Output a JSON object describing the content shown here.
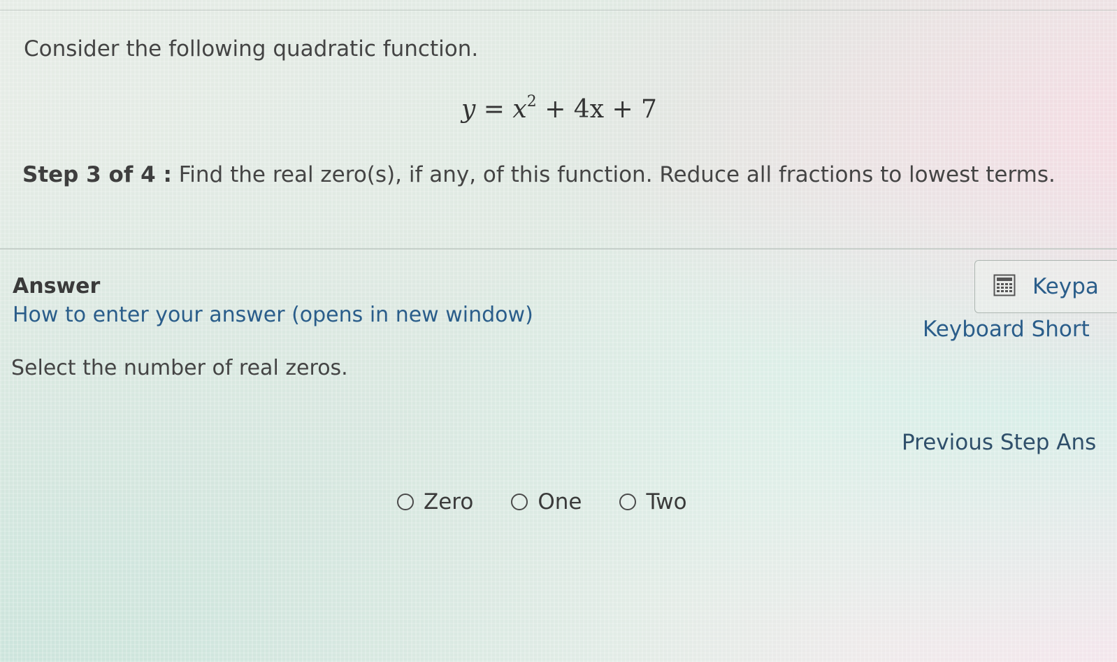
{
  "question": {
    "intro": "Consider the following quadratic function.",
    "equation": {
      "lhs": "y",
      "equals": "=",
      "base": "x",
      "exponent": "2",
      "rest": "+ 4x + 7"
    },
    "step_label": "Step 3 of 4 :",
    "step_text": "Find the real zero(s), if any, of this function. Reduce all fractions to lowest terms."
  },
  "answer": {
    "heading": "Answer",
    "help_link": "How to enter your answer (opens in new window)",
    "prompt": "Select the number of real zeros.",
    "options": [
      {
        "label": "Zero"
      },
      {
        "label": "One"
      },
      {
        "label": "Two"
      }
    ]
  },
  "sidebar": {
    "keypad_label": "Keypa",
    "keypad_icon": "calculator-icon",
    "shortcuts_label": "Keyboard Short",
    "previous_step_label": "Previous Step Ans"
  },
  "colors": {
    "link": "#2a5d8a",
    "text": "#444444"
  }
}
